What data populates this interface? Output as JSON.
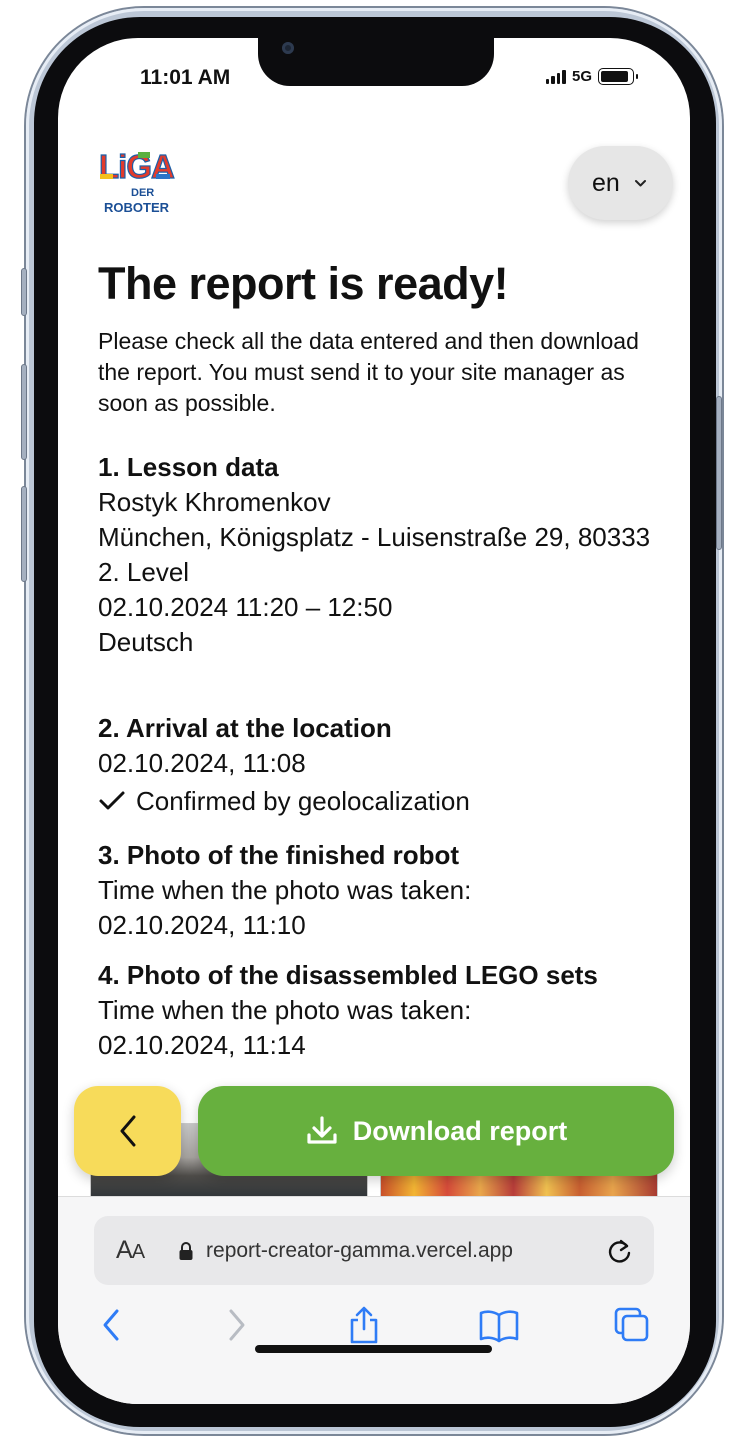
{
  "status_bar": {
    "time": "11:01 AM",
    "network": "5G"
  },
  "header": {
    "logo_text": [
      "LiGA",
      "DER",
      "ROBOTER"
    ],
    "language": {
      "selected": "en"
    }
  },
  "page": {
    "title": "The report is ready!",
    "intro": "Please check all the data entered and then download the report. You must send it to your site manager as soon as possible."
  },
  "sections": {
    "lesson": {
      "heading": "1. Lesson data",
      "teacher": "Rostyk Khromenkov",
      "location": "München, Königsplatz - Luisenstraße 29, 80333",
      "level": "2. Level",
      "datetime": "02.10.2024 11:20 – 12:50",
      "language": "Deutsch"
    },
    "arrival": {
      "heading": "2. Arrival at the location",
      "datetime": "02.10.2024, 11:08",
      "confirmation": "Confirmed by geolocalization"
    },
    "robot_photo": {
      "heading": "3. Photo of the finished robot",
      "label": "Time when the photo was taken:",
      "datetime": "02.10.2024, 11:10"
    },
    "lego_photo": {
      "heading": "4. Photo of the disassembled LEGO sets",
      "label": "Time when the photo was taken:",
      "datetime": "02.10.2024, 11:14"
    }
  },
  "actions": {
    "back_icon": "chevron-left-icon",
    "download_label": "Download report",
    "download_icon": "download-icon"
  },
  "browser": {
    "text_size_label": "AA",
    "url": "report-creator-gamma.vercel.app",
    "toolbar_icons": [
      "back-icon",
      "forward-icon",
      "share-icon",
      "bookmarks-icon",
      "tabs-icon"
    ]
  },
  "colors": {
    "download_button": "#67b03e",
    "back_button": "#f7db5a",
    "browser_accent": "#2f7cf6",
    "language_pill": "#e6e6e6"
  }
}
